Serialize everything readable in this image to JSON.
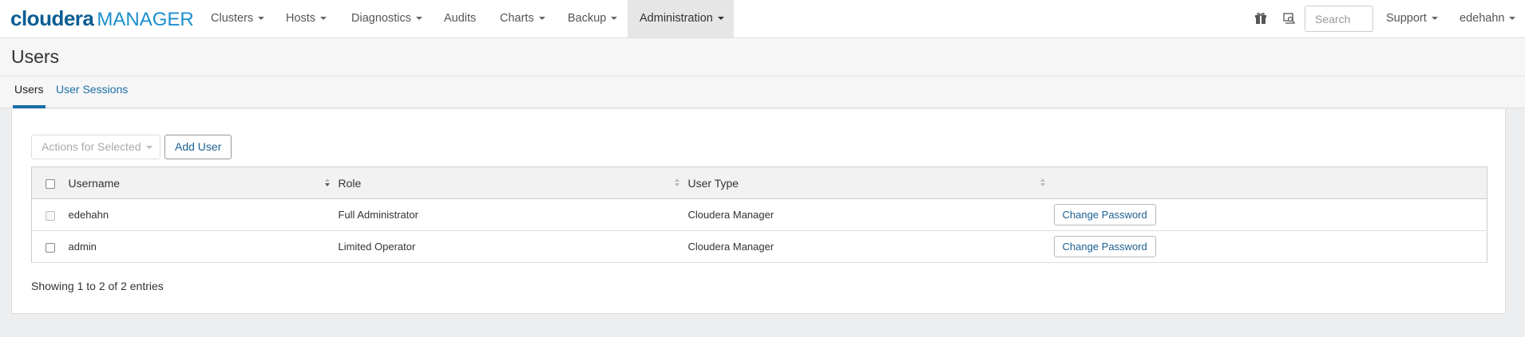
{
  "brand": {
    "name": "cloudera",
    "product": "MANAGER"
  },
  "nav": {
    "items": [
      {
        "label": "Clusters",
        "dropdown": true
      },
      {
        "label": "Hosts",
        "dropdown": true
      },
      {
        "label": "Diagnostics",
        "dropdown": true
      },
      {
        "label": "Audits",
        "dropdown": false
      },
      {
        "label": "Charts",
        "dropdown": true
      },
      {
        "label": "Backup",
        "dropdown": true
      },
      {
        "label": "Administration",
        "dropdown": true,
        "active": true
      }
    ],
    "right": {
      "search_placeholder": "Search",
      "support_label": "Support",
      "user_label": "edehahn",
      "icons": [
        "gift-icon",
        "parcel-icon"
      ]
    }
  },
  "page": {
    "title": "Users"
  },
  "tabs": [
    {
      "label": "Users",
      "active": true
    },
    {
      "label": "User Sessions",
      "active": false
    }
  ],
  "toolbar": {
    "actions_label": "Actions for Selected",
    "add_user_label": "Add User"
  },
  "table": {
    "columns": [
      "Username",
      "Role",
      "User Type"
    ],
    "rows": [
      {
        "username": "edehahn",
        "role": "Full Administrator",
        "user_type": "Cloudera Manager",
        "action": "Change Password"
      },
      {
        "username": "admin",
        "role": "Limited Operator",
        "user_type": "Cloudera Manager",
        "action": "Change Password"
      }
    ],
    "info": "Showing 1 to 2 of 2 entries"
  },
  "colors": {
    "brand_dark": "#0a5d91",
    "brand_light": "#1b8fcf",
    "link": "#1a6fa8"
  }
}
